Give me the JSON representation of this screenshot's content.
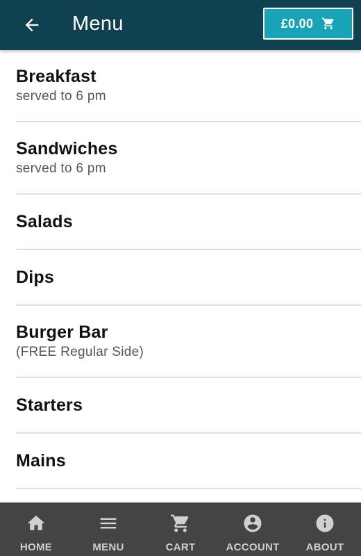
{
  "header": {
    "title": "Menu",
    "cart_amount": "£0.00",
    "bg_color": "#0f4151",
    "cart_button_color": "#18a4b6"
  },
  "menu_items": [
    {
      "title": "Breakfast",
      "subtitle": "served to 6 pm"
    },
    {
      "title": "Sandwiches",
      "subtitle": "served to 6 pm"
    },
    {
      "title": "Salads",
      "subtitle": ""
    },
    {
      "title": "Dips",
      "subtitle": ""
    },
    {
      "title": "Burger Bar",
      "subtitle": "(FREE Regular Side)"
    },
    {
      "title": "Starters",
      "subtitle": ""
    },
    {
      "title": "Mains",
      "subtitle": ""
    }
  ],
  "bottom_nav": [
    {
      "label": "HOME",
      "icon": "home-icon"
    },
    {
      "label": "MENU",
      "icon": "menu-icon"
    },
    {
      "label": "CART",
      "icon": "cart-icon"
    },
    {
      "label": "ACCOUNT",
      "icon": "account-icon"
    },
    {
      "label": "ABOUT",
      "icon": "info-icon"
    }
  ]
}
